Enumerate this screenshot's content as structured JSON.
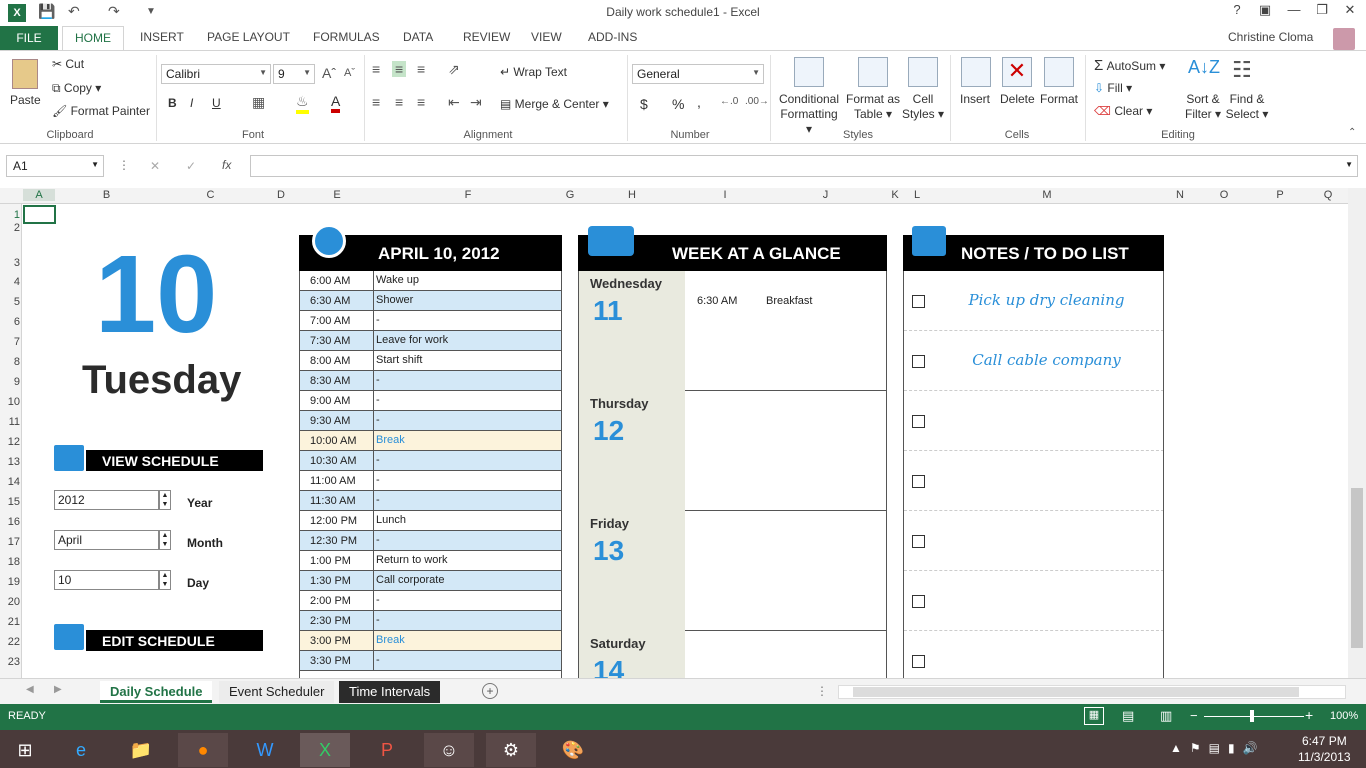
{
  "window": {
    "title": "Daily work schedule1 - Excel",
    "user": "Christine Cloma",
    "help": "?"
  },
  "tabs": [
    "HOME",
    "INSERT",
    "PAGE LAYOUT",
    "FORMULAS",
    "DATA",
    "REVIEW",
    "VIEW",
    "ADD-INS"
  ],
  "file_tab": "FILE",
  "ribbon": {
    "clipboard": {
      "paste": "Paste",
      "cut": "Cut",
      "copy": "Copy",
      "format_painter": "Format Painter",
      "label": "Clipboard"
    },
    "font": {
      "name": "Calibri",
      "size": "9",
      "bold": "B",
      "italic": "I",
      "underline": "U",
      "label": "Font"
    },
    "alignment": {
      "wrap": "Wrap Text",
      "merge": "Merge & Center",
      "label": "Alignment"
    },
    "number": {
      "format": "General",
      "currency": "$",
      "percent": "%",
      "comma": ",",
      "label": "Number"
    },
    "styles": {
      "cond1": "Conditional",
      "cond2": "Formatting",
      "fmt1": "Format as",
      "fmt2": "Table",
      "cell1": "Cell",
      "cell2": "Styles",
      "label": "Styles"
    },
    "cells": {
      "insert": "Insert",
      "delete": "Delete",
      "format": "Format",
      "label": "Cells"
    },
    "editing": {
      "autosum": "AutoSum",
      "fill": "Fill",
      "clear": "Clear",
      "sort1": "Sort &",
      "sort2": "Filter",
      "find1": "Find &",
      "find2": "Select",
      "label": "Editing"
    }
  },
  "formula": {
    "namebox": "A1",
    "fx": "fx",
    "cancel": "✕",
    "enter": "✓"
  },
  "columns": [
    "A",
    "B",
    "C",
    "D",
    "E",
    "F",
    "G",
    "H",
    "I",
    "J",
    "K",
    "L",
    "M",
    "N",
    "O",
    "P",
    "Q"
  ],
  "rows": [
    "1",
    "2",
    "3",
    "4",
    "5",
    "6",
    "7",
    "8",
    "9",
    "10",
    "11",
    "12",
    "13",
    "14",
    "15",
    "16",
    "17",
    "18",
    "19",
    "20",
    "21",
    "22",
    "23"
  ],
  "left": {
    "day_number": "10",
    "day_name": "Tuesday",
    "view_schedule": "VIEW SCHEDULE",
    "edit_schedule": "EDIT SCHEDULE",
    "year_val": "2012",
    "year_lbl": "Year",
    "month_val": "April",
    "month_lbl": "Month",
    "day_val": "10",
    "day_lbl": "Day"
  },
  "schedule": {
    "header": "APRIL 10, 2012",
    "rows": [
      {
        "t": "6:00 AM",
        "a": "Wake up"
      },
      {
        "t": "6:30 AM",
        "a": "Shower"
      },
      {
        "t": "7:00 AM",
        "a": "-"
      },
      {
        "t": "7:30 AM",
        "a": "Leave for work"
      },
      {
        "t": "8:00 AM",
        "a": "Start shift"
      },
      {
        "t": "8:30 AM",
        "a": "-"
      },
      {
        "t": "9:00 AM",
        "a": "-"
      },
      {
        "t": "9:30 AM",
        "a": "-"
      },
      {
        "t": "10:00 AM",
        "a": "Break"
      },
      {
        "t": "10:30 AM",
        "a": "-"
      },
      {
        "t": "11:00 AM",
        "a": "-"
      },
      {
        "t": "11:30 AM",
        "a": "-"
      },
      {
        "t": "12:00 PM",
        "a": "Lunch"
      },
      {
        "t": "12:30 PM",
        "a": "-"
      },
      {
        "t": "1:00 PM",
        "a": "Return to work"
      },
      {
        "t": "1:30 PM",
        "a": "Call corporate"
      },
      {
        "t": "2:00 PM",
        "a": "-"
      },
      {
        "t": "2:30 PM",
        "a": "-"
      },
      {
        "t": "3:00 PM",
        "a": "Break"
      },
      {
        "t": "3:30 PM",
        "a": "-"
      }
    ]
  },
  "week": {
    "header": "WEEK AT A GLANCE",
    "days": [
      {
        "name": "Wednesday",
        "num": "11",
        "time": "6:30 AM",
        "event": "Breakfast"
      },
      {
        "name": "Thursday",
        "num": "12"
      },
      {
        "name": "Friday",
        "num": "13"
      },
      {
        "name": "Saturday",
        "num": "14"
      }
    ]
  },
  "notes": {
    "header": "NOTES / TO DO LIST",
    "items": [
      "Pick up dry cleaning",
      "Call cable company",
      "",
      "",
      "",
      "",
      ""
    ]
  },
  "sheets": [
    "Daily Schedule",
    "Event Scheduler",
    "Time Intervals"
  ],
  "status": {
    "ready": "READY",
    "zoom": "100%"
  },
  "taskbar": {
    "time": "6:47 PM",
    "date": "11/3/2013"
  },
  "colors": {
    "accent": "#217346",
    "blue": "#2a8fd8",
    "light_blue": "#d3e8f7",
    "break": "#fcf3dc"
  }
}
